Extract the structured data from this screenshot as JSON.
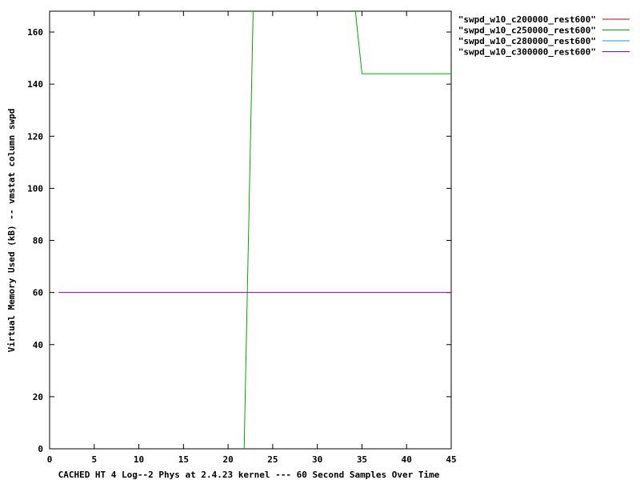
{
  "chart_data": {
    "type": "line",
    "title": "",
    "xlabel": "CACHED HT 4 Log--2 Phys at 2.4.23 kernel --- 60 Second Samples Over Time",
    "ylabel": "Virtual Memory Used (kB) -- vmstat column swpd",
    "xlim": [
      0,
      45
    ],
    "ylim": [
      0,
      168
    ],
    "xticks": [
      0,
      5,
      10,
      15,
      20,
      25,
      30,
      35,
      40,
      45
    ],
    "yticks": [
      0,
      20,
      40,
      60,
      80,
      100,
      120,
      140,
      160
    ],
    "grid": false,
    "legend_position": "top-right outside",
    "series": [
      {
        "name": "\"swpd_w10_c200000_rest600\"",
        "color": "#cc0000",
        "x": [],
        "y": []
      },
      {
        "name": "\"swpd_w10_c250000_rest600\"",
        "color": "#00aa00",
        "x": [
          21.8,
          22,
          23,
          33.9,
          35,
          45
        ],
        "y": [
          0,
          34,
          200,
          180,
          144,
          144
        ]
      },
      {
        "name": "\"swpd_w10_c280000_rest600\"",
        "color": "#3090b8",
        "x": [],
        "y": []
      },
      {
        "name": "\"swpd_w10_c300000_rest600\"",
        "color": "#aa00aa",
        "x": [
          1,
          45
        ],
        "y": [
          60,
          60
        ]
      }
    ]
  }
}
